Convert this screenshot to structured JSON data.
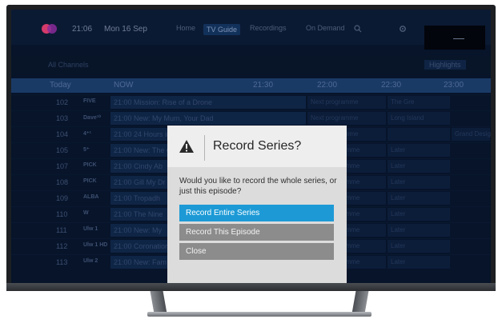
{
  "topbar": {
    "time": "21:06",
    "date": "Mon 16 Sep",
    "nav": [
      "Home",
      "TV Guide",
      "Recordings",
      "On Demand"
    ],
    "active_nav_index": 1,
    "icons": [
      "search-icon",
      "settings-icon"
    ]
  },
  "subbar": {
    "left": "All Channels",
    "right": "Highlights"
  },
  "timeline": {
    "first": "NOW",
    "times": [
      "21:30",
      "22:00",
      "22:30",
      "23:00"
    ]
  },
  "channels": [
    {
      "num": "102",
      "logo": "FIVE",
      "now": "21:00 Mission: Rise of a Drone",
      "later": [
        "Next programme",
        "The Gre"
      ]
    },
    {
      "num": "103",
      "logo": "Dave¹⁰",
      "now": "21:00 New: My Mum, Your Dad",
      "later": [
        "Next programme",
        "Long Island"
      ]
    },
    {
      "num": "104",
      "logo": "4⁺¹",
      "now": "21:00 24 Hours in A&E",
      "later": [
        "Next programme",
        "",
        "Grand Designs"
      ]
    },
    {
      "num": "105",
      "logo": "5⁺",
      "now": "21:00 New: The Ch",
      "later": [
        "Later programme",
        "Later"
      ]
    },
    {
      "num": "107",
      "logo": "PICK",
      "now": "21:00 Cindy Ab",
      "later": [
        "Later programme",
        "Later"
      ]
    },
    {
      "num": "108",
      "logo": "PICK",
      "now": "21:00 Gill My Dr",
      "later": [
        "Later programme",
        "Later"
      ]
    },
    {
      "num": "109",
      "logo": "ALBA",
      "now": "21:00 Tropadh",
      "later": [
        "Later programme",
        "Later"
      ]
    },
    {
      "num": "110",
      "logo": "W",
      "now": "21:00 The Nine",
      "later": [
        "Later programme",
        "Later"
      ]
    },
    {
      "num": "111",
      "logo": "Ulw 1",
      "now": "21:00 New: My",
      "later": [
        "Later programme",
        "Later"
      ]
    },
    {
      "num": "112",
      "logo": "Ulw 1 HD",
      "now": "21:00 Coronation",
      "later": [
        "Later programme",
        "Later"
      ]
    },
    {
      "num": "113",
      "logo": "Ulw 2",
      "now": "21:00 New: Fam",
      "later": [
        "Later programme",
        "Later"
      ]
    }
  ],
  "modal": {
    "title": "Record Series?",
    "body": "Would you like to record the whole series, or just this episode?",
    "options": [
      "Record Entire Series",
      "Record This Episode",
      "Close"
    ],
    "selected_index": 0,
    "icon": "warning-icon"
  },
  "colors": {
    "accent": "#1d9ad6",
    "option_bg": "#8c8c8c",
    "modal_bg": "#dcdcdc",
    "screen_bg": "#07142a"
  }
}
